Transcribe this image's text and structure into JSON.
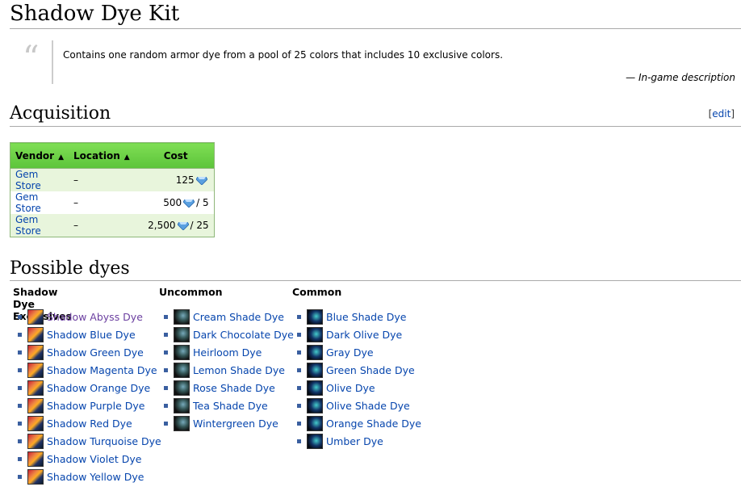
{
  "page": {
    "title": "Shadow Dye Kit"
  },
  "quote": {
    "text": "Contains one random armor dye from a pool of 25 colors that includes 10 exclusive colors.",
    "source": "— In-game description"
  },
  "acquisition": {
    "heading": "Acquisition",
    "edit_open": "[",
    "edit_label": "edit",
    "edit_close": "]",
    "headers": [
      "Vendor",
      "Location",
      "Cost"
    ],
    "rows": [
      {
        "vendor": "Gem Store",
        "location": "–",
        "cost": "125",
        "suffix": ""
      },
      {
        "vendor": "Gem Store",
        "location": "–",
        "cost": "500",
        "suffix": "/ 5"
      },
      {
        "vendor": "Gem Store",
        "location": "–",
        "cost": "2,500",
        "suffix": "/ 25"
      }
    ]
  },
  "dyes": {
    "heading": "Possible dyes",
    "exclusives": {
      "title": "Shadow Dye Exclusives",
      "items": [
        "Shadow Abyss Dye",
        "Shadow Blue Dye",
        "Shadow Green Dye",
        "Shadow Magenta Dye",
        "Shadow Orange Dye",
        "Shadow Purple Dye",
        "Shadow Red Dye",
        "Shadow Turquoise Dye",
        "Shadow Violet Dye",
        "Shadow Yellow Dye"
      ]
    },
    "uncommon": {
      "title": "Uncommon",
      "items": [
        "Cream Shade Dye",
        "Dark Chocolate Dye",
        "Heirloom Dye",
        "Lemon Shade Dye",
        "Rose Shade Dye",
        "Tea Shade Dye",
        "Wintergreen Dye"
      ]
    },
    "common": {
      "title": "Common",
      "items": [
        "Blue Shade Dye",
        "Dark Olive Dye",
        "Gray Dye",
        "Green Shade Dye",
        "Olive Dye",
        "Olive Shade Dye",
        "Orange Shade Dye",
        "Umber Dye"
      ]
    }
  },
  "colors": {
    "link": "#0645ad",
    "visited_link": "#6b3fa0",
    "table_header": "#6fd24a",
    "table_row_alt": "#e8f5dc",
    "gem_icon": "#5aa0e0"
  },
  "icons": {
    "quote": "quote-mark-icon",
    "sort": "sort-arrows-icon",
    "gem": "gem-icon",
    "exclusive_dye": "exclusive-dye-icon",
    "uncommon_dye": "uncommon-dye-icon",
    "common_dye": "common-dye-icon"
  }
}
